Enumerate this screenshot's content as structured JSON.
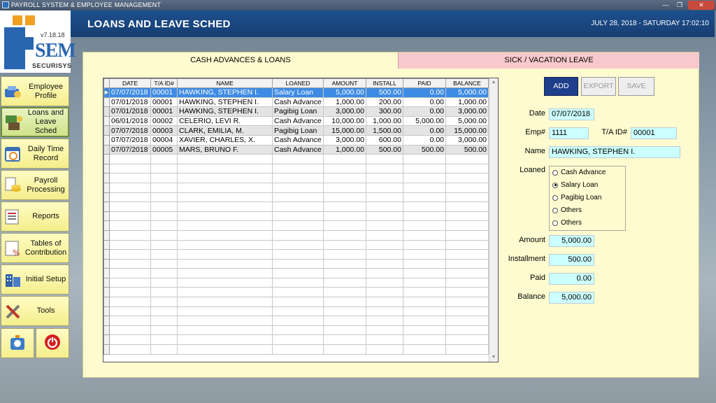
{
  "window": {
    "title": "PAYROLL SYSTEM & EMPLOYEE MANAGEMENT",
    "minimize": "—",
    "maximize": "❐",
    "close": "✕"
  },
  "logo": {
    "version": "v7.18.18",
    "brand": "SEM",
    "company": "SECURISYS"
  },
  "sidebar": {
    "items": [
      {
        "label": "Employee Profile",
        "icon": "employee-profile-icon"
      },
      {
        "label": "Loans and Leave Sched",
        "icon": "loans-icon",
        "active": true
      },
      {
        "label": "Daily Time Record",
        "icon": "calendar-clock-icon"
      },
      {
        "label": "Payroll Processing",
        "icon": "payroll-icon"
      },
      {
        "label": "Reports",
        "icon": "reports-icon"
      },
      {
        "label": "Tables of Contribution",
        "icon": "contribution-table-icon"
      },
      {
        "label": "Initial Setup",
        "icon": "building-icon"
      },
      {
        "label": "Tools",
        "icon": "tools-icon"
      }
    ],
    "bottom": [
      {
        "icon": "timer-icon"
      },
      {
        "icon": "power-icon"
      }
    ]
  },
  "header": {
    "title": "LOANS AND LEAVE SCHED",
    "datetime": "JULY 28, 2018 - SATURDAY 17:02:10"
  },
  "tabs": [
    {
      "label": "CASH ADVANCES & LOANS",
      "active": true
    },
    {
      "label": "SICK / VACATION LEAVE",
      "active": false
    }
  ],
  "table": {
    "columns": [
      "DATE",
      "T/A ID#",
      "NAME",
      "LOANED",
      "AMOUNT",
      "INSTALL",
      "PAID",
      "BALANCE"
    ],
    "rows": [
      [
        "07/07/2018",
        "00001",
        "HAWKING, STEPHEN I.",
        "Salary Loan",
        "5,000.00",
        "500.00",
        "0.00",
        "5,000.00"
      ],
      [
        "07/01/2018",
        "00001",
        "HAWKING, STEPHEN I.",
        "Cash Advance",
        "1,000.00",
        "200.00",
        "0.00",
        "1,000.00"
      ],
      [
        "07/01/2018",
        "00001",
        "HAWKING, STEPHEN I.",
        "Pagibig Loan",
        "3,000.00",
        "300.00",
        "0.00",
        "3,000.00"
      ],
      [
        "06/01/2018",
        "00002",
        "CELERIO, LEVI R.",
        "Cash Advance",
        "10,000.00",
        "1,000.00",
        "5,000.00",
        "5,000.00"
      ],
      [
        "07/07/2018",
        "00003",
        "CLARK, EMILIA, M.",
        "Pagibig Loan",
        "15,000.00",
        "1,500.00",
        "0.00",
        "15,000.00"
      ],
      [
        "07/07/2018",
        "00004",
        "XAVIER, CHARLES, X.",
        "Cash Advance",
        "3,000.00",
        "600.00",
        "0.00",
        "3,000.00"
      ],
      [
        "07/07/2018",
        "00005",
        "MARS, BRUNO F.",
        "Cash Advance",
        "1,000.00",
        "500.00",
        "500.00",
        "500.00"
      ]
    ],
    "selected_row": 0
  },
  "form": {
    "buttons": {
      "add": "ADD",
      "export": "EXPORT",
      "save": "SAVE"
    },
    "date_label": "Date",
    "date_value": "07/07/2018",
    "emp_label": "Emp#",
    "emp_value": "1111",
    "taid_label": "T/A ID#",
    "taid_value": "00001",
    "name_label": "Name",
    "name_value": "HAWKING, STEPHEN I.",
    "loaned_label": "Loaned",
    "loan_options": [
      "Cash Advance",
      "Salary Loan",
      "Pagibig Loan",
      "Others",
      "Others"
    ],
    "loan_selected": 1,
    "amount_label": "Amount",
    "amount_value": "5,000.00",
    "installment_label": "Installment",
    "installment_value": "500.00",
    "paid_label": "Paid",
    "paid_value": "0.00",
    "balance_label": "Balance",
    "balance_value": "5,000.00"
  }
}
